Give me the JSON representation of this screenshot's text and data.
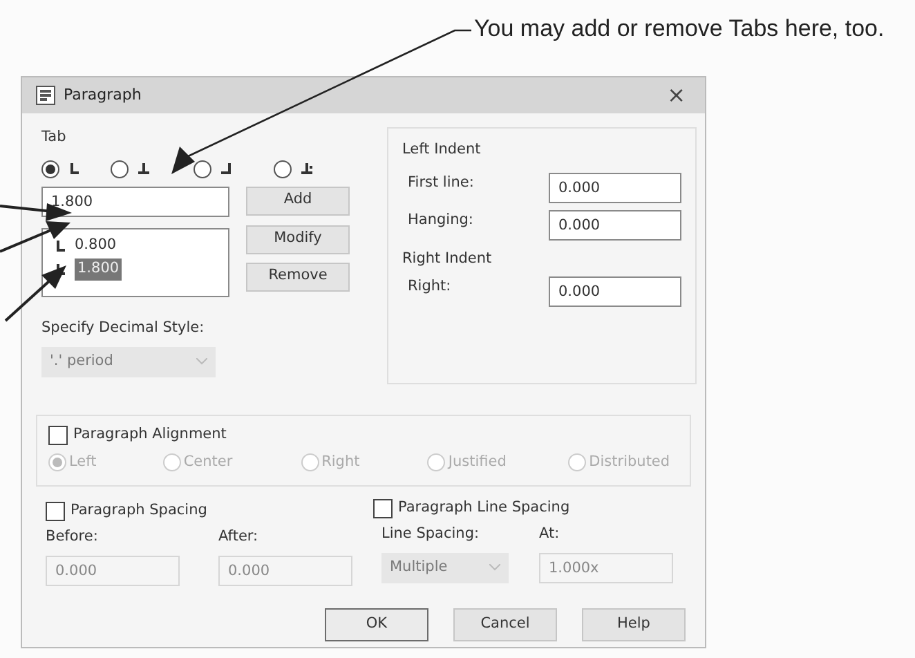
{
  "callout": "You may add or remove Tabs here, too.",
  "window": {
    "title": "Paragraph",
    "close": "×"
  },
  "tab_group": {
    "label": "Tab",
    "tab_types": [
      {
        "kind": "left",
        "selected": true
      },
      {
        "kind": "center",
        "selected": false
      },
      {
        "kind": "right",
        "selected": false
      },
      {
        "kind": "decimal",
        "selected": false
      }
    ],
    "position": {
      "value": "1.800"
    },
    "tab_list": [
      {
        "kind": "left",
        "text": "0.800",
        "selected": false
      },
      {
        "kind": "left",
        "text": "1.800",
        "selected": true
      }
    ],
    "buttons": [
      "Add",
      "Modify",
      "Remove"
    ],
    "decimal_style": {
      "label": "Specify Decimal Style:",
      "value": "'.' period",
      "disabled": true
    }
  },
  "indent": {
    "left_label": "Left Indent",
    "fields": [
      {
        "kind": "left",
        "label": "First line:",
        "value": "0.000"
      },
      {
        "kind": "left",
        "label": "Hanging:",
        "value": "0.000"
      },
      {
        "kind": "right",
        "label": "Right:",
        "value": "0.000"
      }
    ],
    "right_label": "Right Indent"
  },
  "alignment": {
    "label": "Paragraph Alignment",
    "checked": false,
    "options": [
      {
        "label": "Left",
        "selected": true,
        "disabled": true
      },
      {
        "label": "Center",
        "selected": false,
        "disabled": true
      },
      {
        "label": "Right",
        "selected": false,
        "disabled": true
      },
      {
        "label": "Justified",
        "selected": false,
        "disabled": true
      },
      {
        "label": "Distributed",
        "selected": false,
        "disabled": true
      }
    ]
  },
  "spacing": {
    "label": "Paragraph Spacing",
    "checked": false,
    "before": {
      "label": "Before:",
      "value": "0.000",
      "disabled": true
    },
    "after": {
      "label": "After:",
      "value": "0.000",
      "disabled": true
    }
  },
  "line_spacing": {
    "label": "Paragraph Line Spacing",
    "checked": false,
    "type": {
      "label": "Line Spacing:",
      "value": "Multiple",
      "disabled": true
    },
    "at": {
      "label": "At:",
      "value": "1.000x",
      "disabled": true
    }
  },
  "footer_buttons": [
    {
      "label": "OK",
      "selected": true
    },
    {
      "label": "Cancel",
      "selected": false
    },
    {
      "label": "Help",
      "selected": false
    }
  ]
}
